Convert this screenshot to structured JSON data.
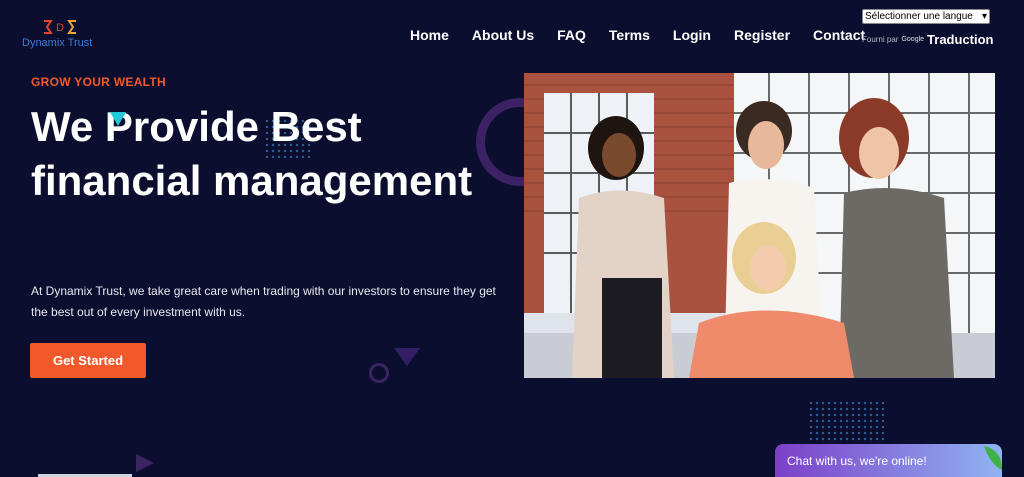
{
  "brand": {
    "name": "Dynamix Trust",
    "logo_letter": "D"
  },
  "nav": [
    {
      "label": "Home"
    },
    {
      "label": "About Us"
    },
    {
      "label": "FAQ"
    },
    {
      "label": "Terms"
    },
    {
      "label": "Login"
    },
    {
      "label": "Register"
    },
    {
      "label": "Contact"
    }
  ],
  "translate": {
    "select_value": "Sélectionner une langue",
    "powered_by": "Fourni par",
    "google": "Google",
    "translate_label": "Traduction"
  },
  "hero": {
    "eyebrow": "GROW YOUR WEALTH",
    "headline": "We Provide Best financial management",
    "description": "At Dynamix Trust, we take great care when trading with our investors to ensure they get the best out of every investment with us.",
    "cta": "Get Started"
  },
  "chat": {
    "label": "Chat with us, we're online!"
  },
  "colors": {
    "background": "#0b0e2e",
    "accent": "#f2582a",
    "logo_blue": "#3f7ad8",
    "decor_purple": "#3c2164"
  },
  "icons": [
    "logo-icon",
    "chevron-down-icon",
    "chat-leaf-icon"
  ]
}
